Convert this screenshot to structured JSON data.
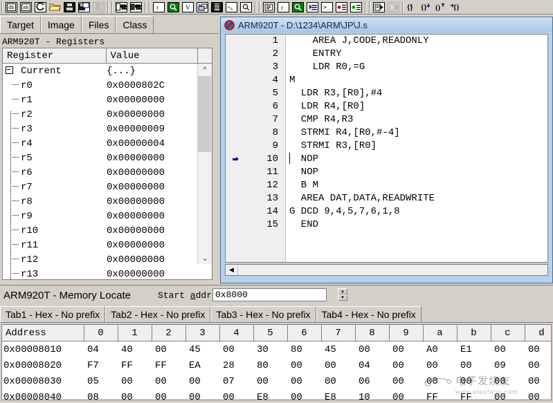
{
  "toolbar": {
    "groups": [
      {
        "buttons": [
          {
            "name": "new-project-icon",
            "glyph": "db",
            "style": "plain"
          },
          {
            "name": "open-workspace-icon",
            "glyph": "ab",
            "style": "plain"
          },
          {
            "name": "reload-icon",
            "glyph": "C",
            "style": "plain"
          },
          {
            "name": "open-folder-icon",
            "glyph": "folder",
            "style": "folder"
          },
          {
            "name": "save-icon",
            "glyph": "disk",
            "style": "black"
          },
          {
            "name": "save-all-icon",
            "glyph": "disks",
            "style": "bsplit"
          },
          {
            "name": "print-icon",
            "glyph": "print",
            "style": "grey"
          }
        ]
      },
      {
        "buttons": [
          {
            "name": "find-icon",
            "glyph": "binoc",
            "style": "plain"
          },
          {
            "name": "find-next-icon",
            "glyph": "binoc2",
            "style": "plain"
          }
        ]
      },
      {
        "buttons": [
          {
            "name": "registers-icon",
            "glyph": "r",
            "style": "plain"
          },
          {
            "name": "search-memory-icon",
            "glyph": "mag",
            "style": "green"
          },
          {
            "name": "variables-icon",
            "glyph": "V",
            "style": "plain"
          },
          {
            "name": "call-stack-icon",
            "glyph": "stack",
            "style": "plain"
          },
          {
            "name": "memory-icon",
            "glyph": "mem",
            "style": "black"
          },
          {
            "name": "watch-icon",
            "glyph": "ab2",
            "style": "plain"
          },
          {
            "name": "inspect-icon",
            "glyph": "mag2",
            "style": "plain"
          }
        ]
      },
      {
        "buttons": [
          {
            "name": "disassembly-icon",
            "glyph": "list",
            "style": "plain"
          },
          {
            "name": "register-view-icon",
            "glyph": "r2",
            "style": "plain"
          },
          {
            "name": "locate-icon",
            "glyph": "mag3",
            "style": "green"
          },
          {
            "name": "source-view-icon",
            "glyph": "src",
            "style": "plain"
          },
          {
            "name": "console-icon",
            "glyph": "cmd",
            "style": "plain"
          },
          {
            "name": "breakpoints-icon",
            "glyph": "bpred",
            "style": "plain"
          },
          {
            "name": "watchpoints-icon",
            "glyph": "bpgreen",
            "style": "plain"
          }
        ]
      },
      {
        "buttons": [
          {
            "name": "run-icon",
            "glyph": "run",
            "style": "plain"
          },
          {
            "name": "stop-icon",
            "glyph": "stop",
            "style": "grey"
          }
        ]
      },
      {
        "buttons": [
          {
            "name": "step-in-icon",
            "glyph": "{}",
            "style": "noborder"
          },
          {
            "name": "step-over-icon",
            "glyph": "{}+",
            "style": "noborder"
          },
          {
            "name": "step-out-icon",
            "glyph": "(}+",
            "style": "noborder"
          },
          {
            "name": "run-to-cursor-icon",
            "glyph": "+{}",
            "style": "noborder"
          }
        ]
      }
    ]
  },
  "left_pane": {
    "tabs": [
      {
        "label": "Target",
        "active": true
      },
      {
        "label": "Image",
        "active": false
      },
      {
        "label": "Files",
        "active": false
      },
      {
        "label": "Class",
        "active": false
      }
    ],
    "panel_title": "ARM920T - Registers",
    "columns": [
      "Register",
      "Value"
    ],
    "rows": [
      {
        "name": "Current",
        "value": "{...}",
        "type": "group"
      },
      {
        "name": "r0",
        "value": "0x0000802C",
        "type": "leaf"
      },
      {
        "name": "r1",
        "value": "0x00000000",
        "type": "leaf"
      },
      {
        "name": "r2",
        "value": "0x00000000",
        "type": "leaf"
      },
      {
        "name": "r3",
        "value": "0x00000009",
        "type": "leaf"
      },
      {
        "name": "r4",
        "value": "0x00000004",
        "type": "leaf"
      },
      {
        "name": "r5",
        "value": "0x00000000",
        "type": "leaf"
      },
      {
        "name": "r6",
        "value": "0x00000000",
        "type": "leaf"
      },
      {
        "name": "r7",
        "value": "0x00000000",
        "type": "leaf"
      },
      {
        "name": "r8",
        "value": "0x00000000",
        "type": "leaf"
      },
      {
        "name": "r9",
        "value": "0x00000000",
        "type": "leaf"
      },
      {
        "name": "r10",
        "value": "0x00000000",
        "type": "leaf"
      },
      {
        "name": "r11",
        "value": "0x00000000",
        "type": "leaf"
      },
      {
        "name": "r12",
        "value": "0x00000000",
        "type": "leaf"
      },
      {
        "name": "r13",
        "value": "0x00000000",
        "type": "leaf"
      }
    ]
  },
  "code_window": {
    "title": "ARM920T - D:\\1234\\ARM\\JP\\J.s",
    "title_icon": "no-entry-icon",
    "lines": [
      {
        "num": "1",
        "text": "    AREA J,CODE,READONLY",
        "marker": false
      },
      {
        "num": "2",
        "text": "    ENTRY",
        "marker": false
      },
      {
        "num": "3",
        "text": "    LDR R0,=G",
        "marker": false
      },
      {
        "num": "4",
        "text": "M",
        "marker": false
      },
      {
        "num": "5",
        "text": "  LDR R3,[R0],#4",
        "marker": false
      },
      {
        "num": "6",
        "text": "  LDR R4,[R0]",
        "marker": false
      },
      {
        "num": "7",
        "text": "  CMP R4,R3",
        "marker": false
      },
      {
        "num": "8",
        "text": "  STRMI R4,[R0,#-4]",
        "marker": false
      },
      {
        "num": "9",
        "text": "  STRMI R3,[R0]",
        "marker": false
      },
      {
        "num": "10",
        "text": "  NOP",
        "marker": true
      },
      {
        "num": "11",
        "text": "  NOP",
        "marker": false
      },
      {
        "num": "12",
        "text": "  B M",
        "marker": false
      },
      {
        "num": "13",
        "text": "  AREA DAT,DATA,READWRITE",
        "marker": false
      },
      {
        "num": "14",
        "text": "G DCD 9,4,5,7,6,1,8",
        "marker": false
      },
      {
        "num": "15",
        "text": "  END",
        "marker": false
      }
    ]
  },
  "memory_pane": {
    "title": "ARM920T - Memory Locate",
    "start_label": "Start address",
    "start_value": "0x8000",
    "tabs": [
      {
        "label": "Tab1 - Hex - No prefix",
        "active": true
      },
      {
        "label": "Tab2 - Hex - No prefix",
        "active": false
      },
      {
        "label": "Tab3 - Hex - No prefix",
        "active": false
      },
      {
        "label": "Tab4 - Hex - No prefix",
        "active": false
      }
    ],
    "columns": [
      "Address",
      "0",
      "1",
      "2",
      "3",
      "4",
      "5",
      "6",
      "7",
      "8",
      "9",
      "a",
      "b",
      "c",
      "d"
    ],
    "rows": [
      {
        "address": "0x00008010",
        "cells": [
          "04",
          "40",
          "00",
          "45",
          "00",
          "30",
          "80",
          "45",
          "00",
          "00",
          "A0",
          "E1",
          "00",
          "00"
        ],
        "highlight": []
      },
      {
        "address": "0x00008020",
        "cells": [
          "F7",
          "FF",
          "FF",
          "EA",
          "28",
          "80",
          "00",
          "00",
          "04",
          "00",
          "00",
          "00",
          "09",
          "00"
        ],
        "highlight": [
          12
        ]
      },
      {
        "address": "0x00008030",
        "cells": [
          "05",
          "00",
          "00",
          "00",
          "07",
          "00",
          "00",
          "00",
          "06",
          "00",
          "00",
          "00",
          "00",
          "00"
        ],
        "highlight": []
      },
      {
        "address": "0x00008040",
        "cells": [
          "08",
          "00",
          "00",
          "00",
          "00",
          "E8",
          "00",
          "E8",
          "10",
          "00",
          "FF",
          "FF",
          "00",
          "00"
        ],
        "highlight": []
      }
    ]
  },
  "watermark": {
    "text": "电子发烧友",
    "sub": "www.elecfans.com"
  },
  "colors": {
    "chrome": "#d4d0c8",
    "title_active": "#a8c6e6",
    "highlight_red": "#d00000",
    "marker_blue": "#00008b",
    "accent_green": "#008000"
  }
}
